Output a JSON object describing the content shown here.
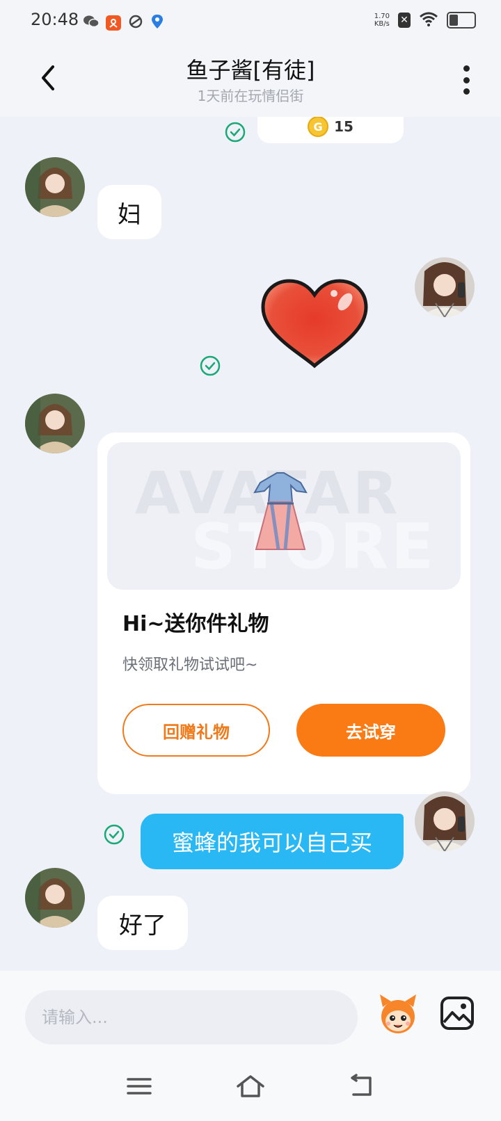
{
  "status_bar": {
    "time": "20:48",
    "net_speed_value": "1.70",
    "net_speed_unit": "KB/s",
    "icons": [
      "wechat-icon",
      "app-icon",
      "sync-icon",
      "location-icon",
      "close-icon",
      "wifi-icon",
      "battery-icon"
    ]
  },
  "header": {
    "title": "鱼子酱[有徒]",
    "subtitle": "1天前在玩情侣街"
  },
  "coin_card": {
    "coin_letter": "G",
    "count": "15"
  },
  "messages": [
    {
      "sender": "other",
      "text": "妇"
    },
    {
      "sender": "me",
      "type": "sticker",
      "sticker": "heart-sticker"
    },
    {
      "sender": "other",
      "type": "gift-card"
    },
    {
      "sender": "me",
      "text": "蜜蜂的我可以自己买"
    },
    {
      "sender": "other",
      "text": "好了"
    }
  ],
  "gift_card": {
    "banner_line1": "AVATAR",
    "banner_line2": "STORE",
    "title": "Hi~送你件礼物",
    "subtitle": "快领取礼物试试吧~",
    "button_return": "回赠礼物",
    "button_try": "去试穿"
  },
  "input": {
    "placeholder": "请输入..."
  },
  "colors": {
    "accent_orange": "#fa7a14",
    "bubble_blue": "#2ab8f5",
    "check_green": "#1aa876",
    "background": "#eef1f7"
  }
}
